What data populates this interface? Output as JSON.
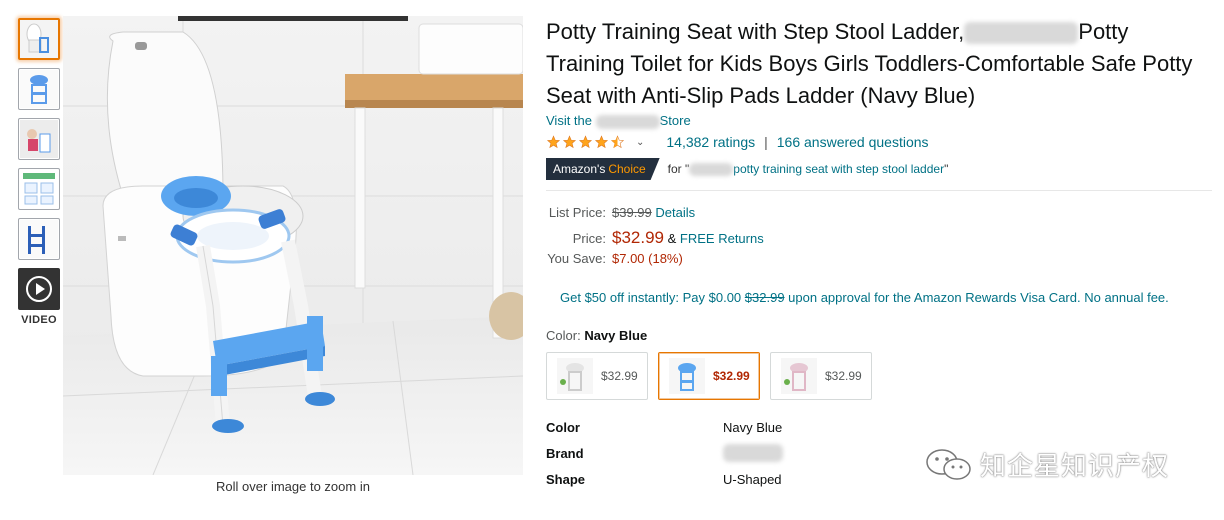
{
  "thumbnails": {
    "video_label": "VIDEO"
  },
  "main_image": {
    "zoom_hint": "Roll over image to zoom in"
  },
  "product": {
    "title_part1": "Potty Training Seat with Step Stool Ladder,",
    "title_part2": "Potty Training Toilet for Kids Boys Girls Toddlers-Comfortable Safe Potty Seat with Anti-Slip Pads Ladder (Navy Blue)",
    "store_prefix": "Visit the",
    "store_suffix": "Store",
    "rating_stars": 4.5,
    "ratings_count": "14,382 ratings",
    "separator": "|",
    "answered": "166 answered questions",
    "badge_amazons": "Amazon's",
    "badge_choice": "Choice",
    "choice_for": "for \"",
    "choice_query": "potty training seat with step stool ladder",
    "choice_close": "\""
  },
  "pricing": {
    "list_label": "List Price:",
    "list_price": "$39.99",
    "details": "Details",
    "price_label": "Price:",
    "price": "$32.99",
    "amp": "&",
    "free_returns": "FREE Returns",
    "save_label": "You Save:",
    "savings": "$7.00 (18%)"
  },
  "promo": {
    "text1": "Get $50 off instantly: Pay $0.00",
    "strike": "$32.99",
    "text2": "upon approval for the Amazon Rewards Visa Card. No annual fee."
  },
  "color": {
    "label": "Color:",
    "selected": "Navy Blue",
    "swatches": [
      {
        "price": "$32.99"
      },
      {
        "price": "$32.99"
      },
      {
        "price": "$32.99"
      }
    ]
  },
  "specs": [
    {
      "key": "Color",
      "value": "Navy Blue"
    },
    {
      "key": "Brand",
      "value": ""
    },
    {
      "key": "Shape",
      "value": "U-Shaped"
    }
  ],
  "watermark": {
    "text": "知企星知识产权"
  },
  "colors": {
    "link": "#007185",
    "price": "#b12704",
    "star": "#ffa41c",
    "badge_bg": "#232f3e",
    "badge_accent": "#ff9900",
    "selected_border": "#e77600"
  }
}
